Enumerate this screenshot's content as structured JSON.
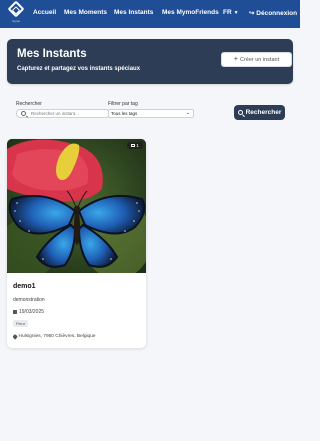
{
  "nav": {
    "logo_text": "mymo",
    "items": [
      "Accueil",
      "Mes Moments",
      "Mes Instants",
      "Mes MymoFriends"
    ],
    "language": "FR",
    "logout": "Déconnexion"
  },
  "header": {
    "title": "Mes Instants",
    "subtitle": "Capturez et partagez vos instants spéciaux",
    "create_button": "Créer un instant"
  },
  "filters": {
    "search_label": "Rechercher",
    "search_placeholder": "Rechercher un instant...",
    "tag_label": "Filtrer par tag",
    "tag_selected": "Tous les tags",
    "search_button": "Rechercher"
  },
  "cards": [
    {
      "photo_count": "1",
      "title": "demo1",
      "description": "demonstration",
      "date": "19/03/2025",
      "tag": "Fleur",
      "location": "Hulsignies, 7950 Chièvres, Belgique"
    }
  ],
  "colors": {
    "nav_bg": "#1f4d96",
    "banner_bg": "#2c3d55",
    "page_bg": "#f4f6f9"
  },
  "icons": [
    "search-icon",
    "plus-icon",
    "logout-icon",
    "calendar-icon",
    "map-pin-icon",
    "image-icon"
  ]
}
